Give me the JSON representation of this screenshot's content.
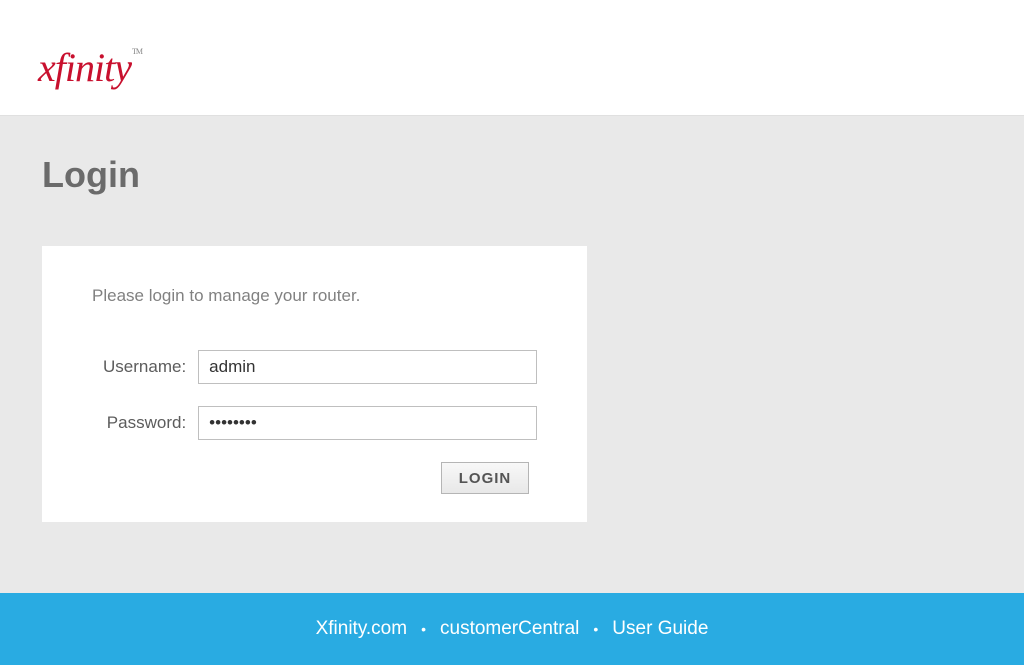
{
  "header": {
    "logo_text": "xfinity"
  },
  "page": {
    "title": "Login"
  },
  "login": {
    "instruction": "Please login to manage your router.",
    "username_label": "Username:",
    "username_value": "admin",
    "password_label": "Password:",
    "password_value": "••••••••",
    "button_label": "LOGIN"
  },
  "footer": {
    "links": [
      "Xfinity.com",
      "customerCentral",
      "User Guide"
    ],
    "separator": "•"
  }
}
